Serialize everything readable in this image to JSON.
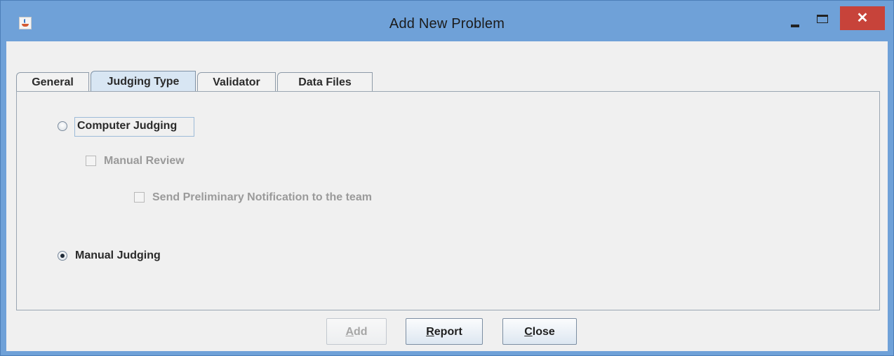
{
  "window": {
    "title": "Add New Problem",
    "close_glyph": "✕",
    "icons": [
      "java-app-icon",
      "minimize-icon",
      "maximize-icon",
      "close-icon"
    ]
  },
  "tabs": [
    {
      "label": "General",
      "selected": false
    },
    {
      "label": "Judging Type",
      "selected": true
    },
    {
      "label": "Validator",
      "selected": false
    },
    {
      "label": "Data Files",
      "selected": false
    }
  ],
  "judging": {
    "computer_judging": {
      "label": "Computer Judging",
      "checked": false
    },
    "manual_review": {
      "label": "Manual Review",
      "checked": false,
      "enabled": false
    },
    "send_notification": {
      "label": "Send Preliminary Notification to the team",
      "checked": false,
      "enabled": false
    },
    "manual_judging": {
      "label": "Manual Judging",
      "checked": true
    }
  },
  "buttons": {
    "add": {
      "first": "A",
      "rest": "dd",
      "enabled": false
    },
    "report": {
      "first": "R",
      "rest": "eport",
      "enabled": true
    },
    "close": {
      "first": "C",
      "rest": "lose",
      "enabled": true
    }
  },
  "colors": {
    "titlebar": "#6fa1d8",
    "close_button": "#c7433a",
    "selected_tab": "#d8e6f3",
    "panel_bg": "#f0f0f0"
  }
}
